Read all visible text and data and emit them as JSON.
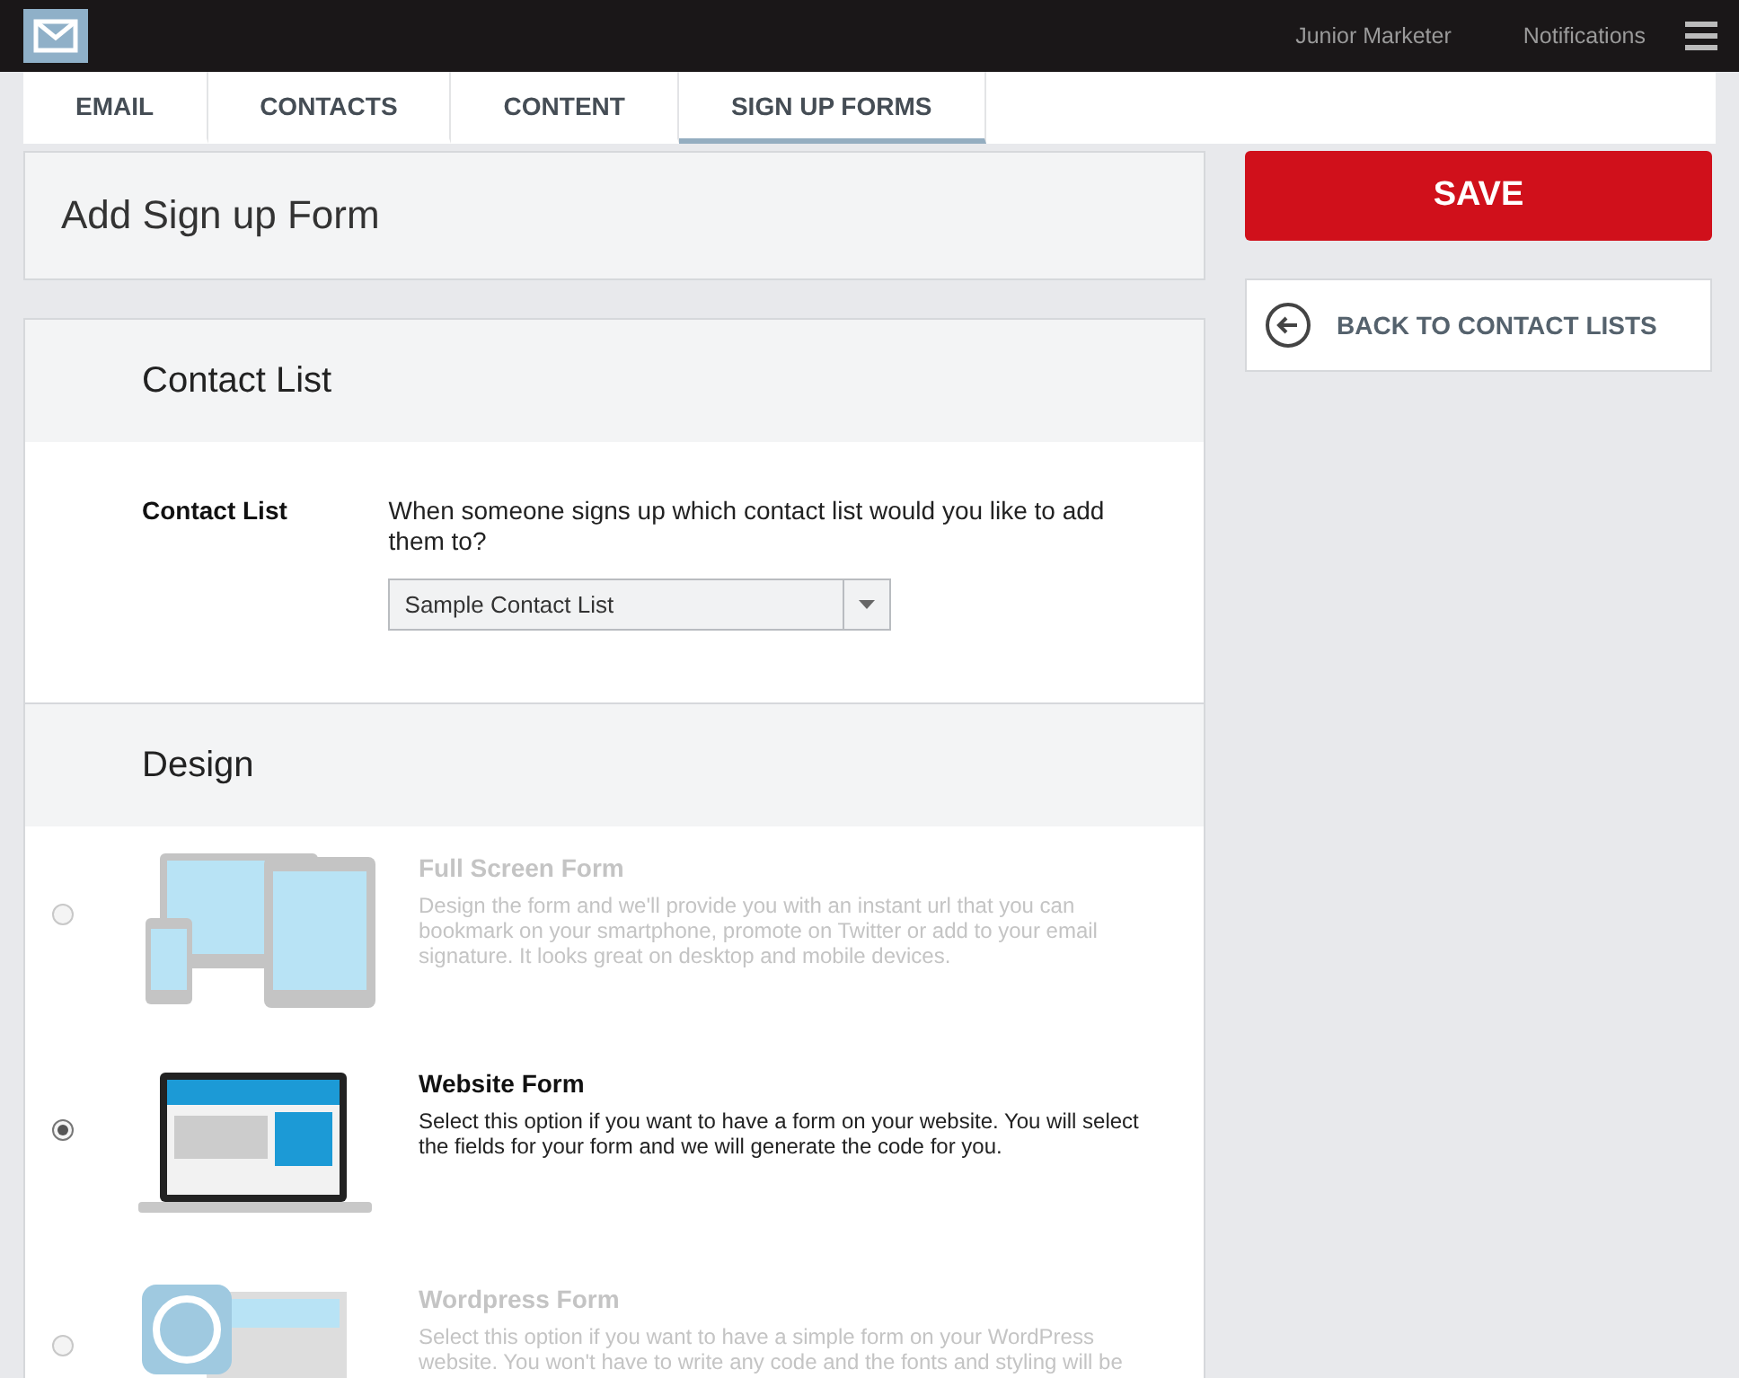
{
  "top_bar": {
    "user": "Junior Marketer",
    "notifications": "Notifications"
  },
  "tabs": [
    {
      "label": "EMAIL",
      "selected": false
    },
    {
      "label": "CONTACTS",
      "selected": false
    },
    {
      "label": "CONTENT",
      "selected": false
    },
    {
      "label": "SIGN UP FORMS",
      "selected": true
    }
  ],
  "page_title": "Add Sign up Form",
  "save_button": "SAVE",
  "back_button": "BACK TO CONTACT LISTS",
  "contact_list_section": {
    "title": "Contact List",
    "label": "Contact List",
    "question": "When someone signs up which contact list would you like to add them to?",
    "select_value": "Sample Contact List"
  },
  "design_section": {
    "title": "Design",
    "options": [
      {
        "kind": "devices",
        "title": "Full Screen Form",
        "description": "Design the form and we'll provide you with an instant url that you can bookmark on your smartphone, promote on Twitter or add to your email signature. It looks great on desktop and mobile devices.",
        "selected": false
      },
      {
        "kind": "laptop",
        "title": "Website Form",
        "description": "Select this option if you want to have a form on your website. You will select the fields for your form and we will generate the code for you.",
        "selected": true
      },
      {
        "kind": "wordpress",
        "title": "Wordpress Form",
        "description": "Select this option if you want to have a simple form on your WordPress website. You won't have to write any code and the fonts and styling will be",
        "selected": false
      }
    ]
  }
}
